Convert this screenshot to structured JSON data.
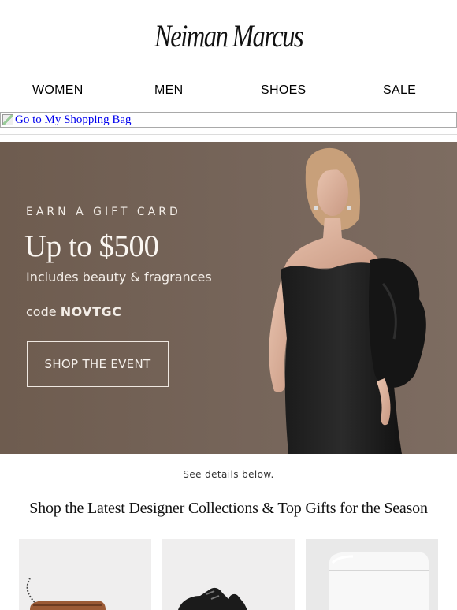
{
  "brand": {
    "logo_text": "Neiman Marcus"
  },
  "nav": {
    "items": [
      "WOMEN",
      "MEN",
      "SHOES",
      "SALE"
    ]
  },
  "shopping_bag_link": {
    "alt_text": "Go to My Shopping Bag"
  },
  "hero": {
    "eyebrow": "EARN A GIFT CARD",
    "headline": "Up to $500",
    "subline": "Includes beauty & fragrances",
    "code_prefix": "code",
    "code": "NOVTGC",
    "cta_label": "SHOP THE EVENT"
  },
  "disclaimer": "See details below.",
  "section": {
    "title": "Shop the Latest Designer Collections & Top Gifts for the Season",
    "tiles": [
      {
        "icon": "handbag-image"
      },
      {
        "icon": "sneaker-image"
      },
      {
        "icon": "cream-jar-image"
      }
    ]
  },
  "colors": {
    "hero_bg": "#76655a",
    "hero_text": "#f3ede7",
    "link": "#0000ee",
    "tile_bg": "#efeeee"
  }
}
